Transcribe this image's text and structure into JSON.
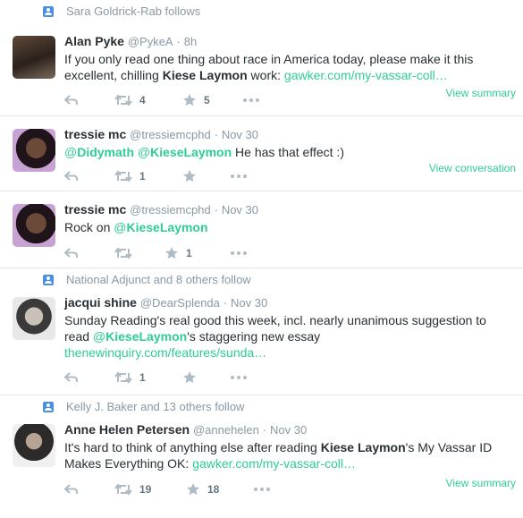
{
  "tweets": [
    {
      "context": "Sara Goldrick-Rab follows",
      "fullname": "Alan Pyke",
      "handle": "@PykeA",
      "time": "8h",
      "text": {
        "p1": "If you only read one thing about race in America today, please make it this excellent, chilling ",
        "bold": "Kiese Laymon",
        "p2": " work: ",
        "link": "gawker.com/my-vassar-coll…"
      },
      "retweets": "4",
      "favorites": "5",
      "summary": "View summary"
    },
    {
      "fullname": "tressie mc",
      "handle": "@tressiemcphd",
      "time": "Nov 30",
      "text": {
        "m1_at": "@",
        "m1_name": "Didymath",
        "m2_at": "@",
        "m2_name": "KieseLaymon",
        "rest": " He has that effect :)"
      },
      "retweets": "1",
      "summary": "View conversation"
    },
    {
      "fullname": "tressie mc",
      "handle": "@tressiemcphd",
      "time": "Nov 30",
      "text": {
        "pre": "Rock on ",
        "m_at": "@",
        "m_name": "KieseLaymon"
      },
      "favorites": "1"
    },
    {
      "context": "National Adjunct and 8 others follow",
      "fullname": "jacqui shine",
      "handle": "@DearSplenda",
      "time": "Nov 30",
      "text": {
        "p1": "Sunday Reading's real good this week, incl. nearly unanimous suggestion to read ",
        "m_at": "@",
        "m_name": "KieseLaymon",
        "p2": "'s staggering new essay",
        "link": "thenewinquiry.com/features/sunda…"
      },
      "retweets": "1"
    },
    {
      "context": "Kelly J. Baker and 13 others follow",
      "fullname": "Anne Helen Petersen",
      "handle": "@annehelen",
      "time": "Nov 30",
      "text": {
        "p1": "It's hard to think of anything else after reading ",
        "bold": "Kiese Laymon",
        "p2": "'s My Vassar ID Makes Everything OK: ",
        "link": "gawker.com/my-vassar-coll…"
      },
      "retweets": "19",
      "favorites": "18",
      "summary": "View summary"
    }
  ],
  "separator_dot": "·",
  "colors": {
    "link": "#2ecc9a",
    "muted": "#8899a6",
    "icon": "#b0bcc5",
    "context_icon": "#4a90e2"
  }
}
